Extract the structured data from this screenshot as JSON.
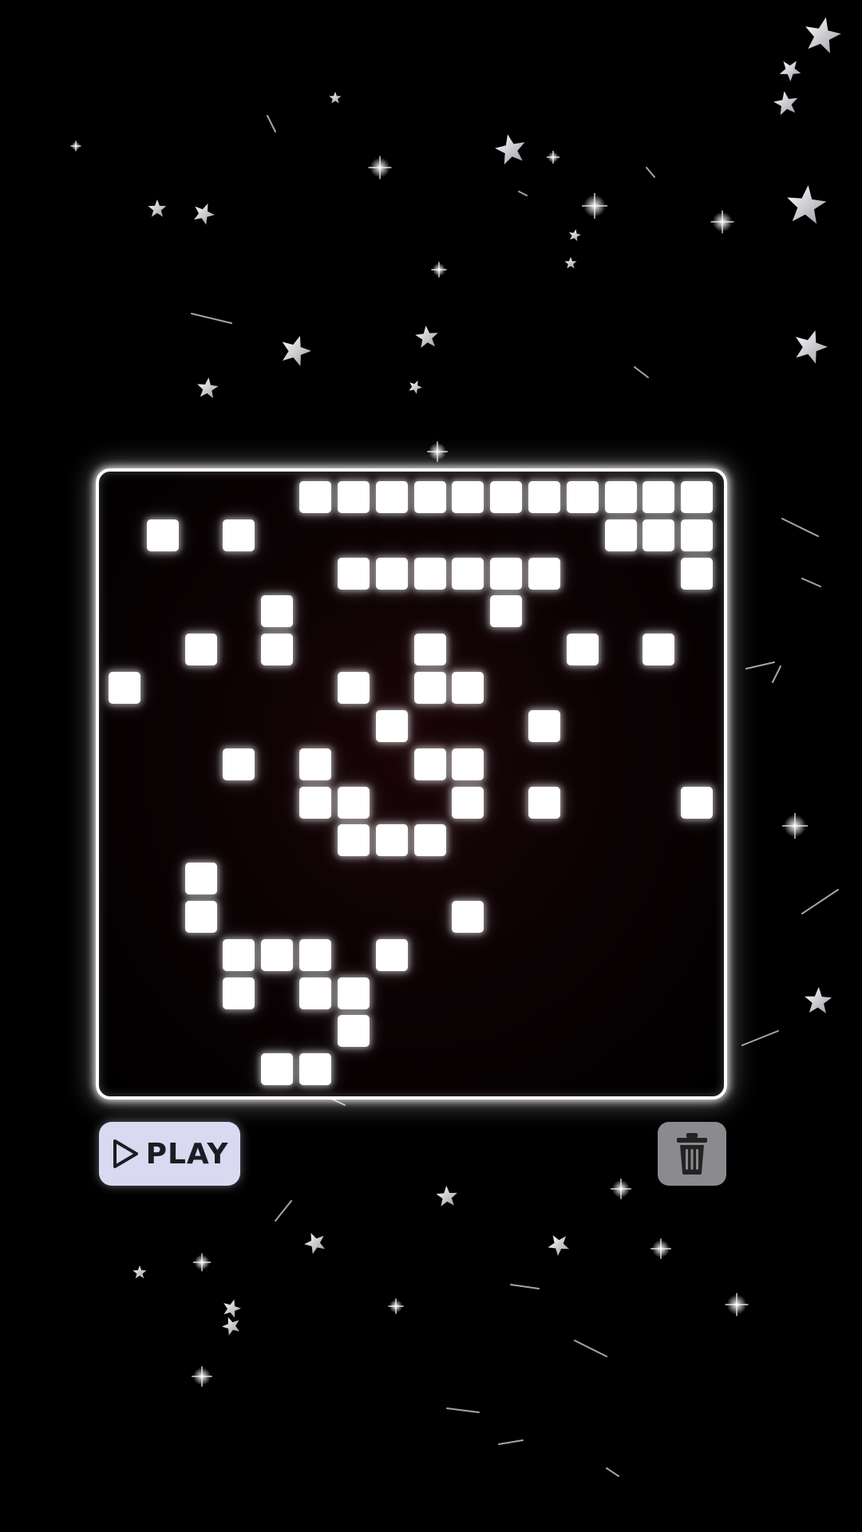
{
  "background": {
    "color": "#000000",
    "star_color": "#ffffff"
  },
  "board": {
    "rows": 16,
    "cols": 16,
    "border_color": "#ffffff",
    "cell_color": "#ffffff",
    "filled": [
      [
        0,
        5
      ],
      [
        0,
        6
      ],
      [
        0,
        7
      ],
      [
        0,
        8
      ],
      [
        0,
        9
      ],
      [
        0,
        10
      ],
      [
        0,
        11
      ],
      [
        0,
        12
      ],
      [
        0,
        13
      ],
      [
        0,
        14
      ],
      [
        0,
        15
      ],
      [
        1,
        1
      ],
      [
        1,
        3
      ],
      [
        1,
        13
      ],
      [
        1,
        14
      ],
      [
        1,
        15
      ],
      [
        2,
        6
      ],
      [
        2,
        7
      ],
      [
        2,
        8
      ],
      [
        2,
        9
      ],
      [
        2,
        10
      ],
      [
        2,
        11
      ],
      [
        2,
        15
      ],
      [
        3,
        4
      ],
      [
        3,
        10
      ],
      [
        4,
        2
      ],
      [
        4,
        4
      ],
      [
        4,
        8
      ],
      [
        4,
        12
      ],
      [
        4,
        14
      ],
      [
        5,
        0
      ],
      [
        5,
        6
      ],
      [
        5,
        8
      ],
      [
        5,
        9
      ],
      [
        6,
        7
      ],
      [
        6,
        11
      ],
      [
        7,
        3
      ],
      [
        7,
        5
      ],
      [
        7,
        8
      ],
      [
        7,
        9
      ],
      [
        8,
        5
      ],
      [
        8,
        6
      ],
      [
        8,
        9
      ],
      [
        8,
        11
      ],
      [
        8,
        15
      ],
      [
        9,
        6
      ],
      [
        9,
        7
      ],
      [
        9,
        8
      ],
      [
        10,
        2
      ],
      [
        11,
        2
      ],
      [
        11,
        9
      ],
      [
        12,
        3
      ],
      [
        12,
        4
      ],
      [
        12,
        5
      ],
      [
        12,
        7
      ],
      [
        13,
        3
      ],
      [
        13,
        5
      ],
      [
        13,
        6
      ],
      [
        14,
        6
      ],
      [
        15,
        4
      ],
      [
        15,
        5
      ]
    ]
  },
  "controls": {
    "play_label": "PLAY",
    "play_icon": "play-triangle-icon",
    "play_bg": "#d9d9f2",
    "trash_icon": "trash-icon",
    "trash_bg": "#8a8a8f"
  }
}
